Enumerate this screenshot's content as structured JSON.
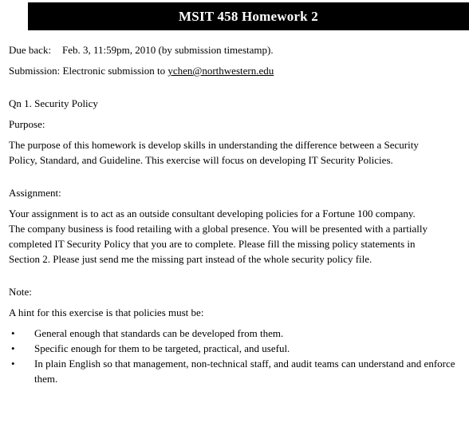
{
  "header": {
    "title": "MSIT 458 Homework 2",
    "background_color": "#000000",
    "text_color": "#ffffff"
  },
  "meta": {
    "due_label": "Due back:",
    "due_value": "Feb. 3, 11:59pm, 2010 (by submission timestamp).",
    "submission_label": "Submission:",
    "submission_prefix": " Electronic submission to ",
    "submission_email": "ychen@northwestern.edu"
  },
  "question": {
    "heading": "Qn 1. Security Policy"
  },
  "purpose": {
    "heading": "Purpose:",
    "body": "The purpose of this homework is develop skills in understanding the difference between a Security Policy, Standard, and Guideline. This exercise will focus on developing IT Security Policies."
  },
  "assignment": {
    "heading": "Assignment:",
    "body": "Your assignment is to act as an outside consultant developing policies for a Fortune 100 company. The company business is food retailing with a global presence. You will be presented with a partially completed IT Security Policy that you are to complete.   Please fill the missing policy statements in Section 2.  Please just send me the missing part instead of the whole security policy file."
  },
  "note": {
    "heading": "Note:",
    "intro": "A hint for this exercise is that policies must be:",
    "bullet_marker": "•",
    "bullets": [
      "General enough that standards can be developed from them.",
      "Specific enough for them to be targeted, practical, and useful.",
      "In plain English so that management, non-technical staff, and audit teams can understand and enforce them."
    ]
  }
}
